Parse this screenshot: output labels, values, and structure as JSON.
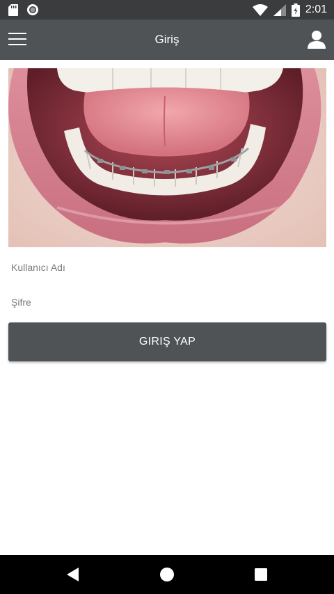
{
  "status_bar": {
    "time": "2:01",
    "icons": [
      "sd-card-icon",
      "sync-icon",
      "wifi-icon",
      "signal-icon",
      "battery-icon"
    ]
  },
  "app_bar": {
    "title": "Giriş",
    "menu_icon": "hamburger-menu-icon",
    "account_icon": "user-icon"
  },
  "login_form": {
    "username_placeholder": "Kullanıcı Adı",
    "username_value": "",
    "password_placeholder": "Şifre",
    "password_value": "",
    "submit_label": "GIRIŞ YAP"
  },
  "nav_bar": {
    "icons": [
      "back-icon",
      "home-icon",
      "recents-icon"
    ]
  },
  "colors": {
    "status_bar": "#3a3c3e",
    "app_bar": "#505356",
    "button": "#505356",
    "nav_bar": "#000000"
  }
}
